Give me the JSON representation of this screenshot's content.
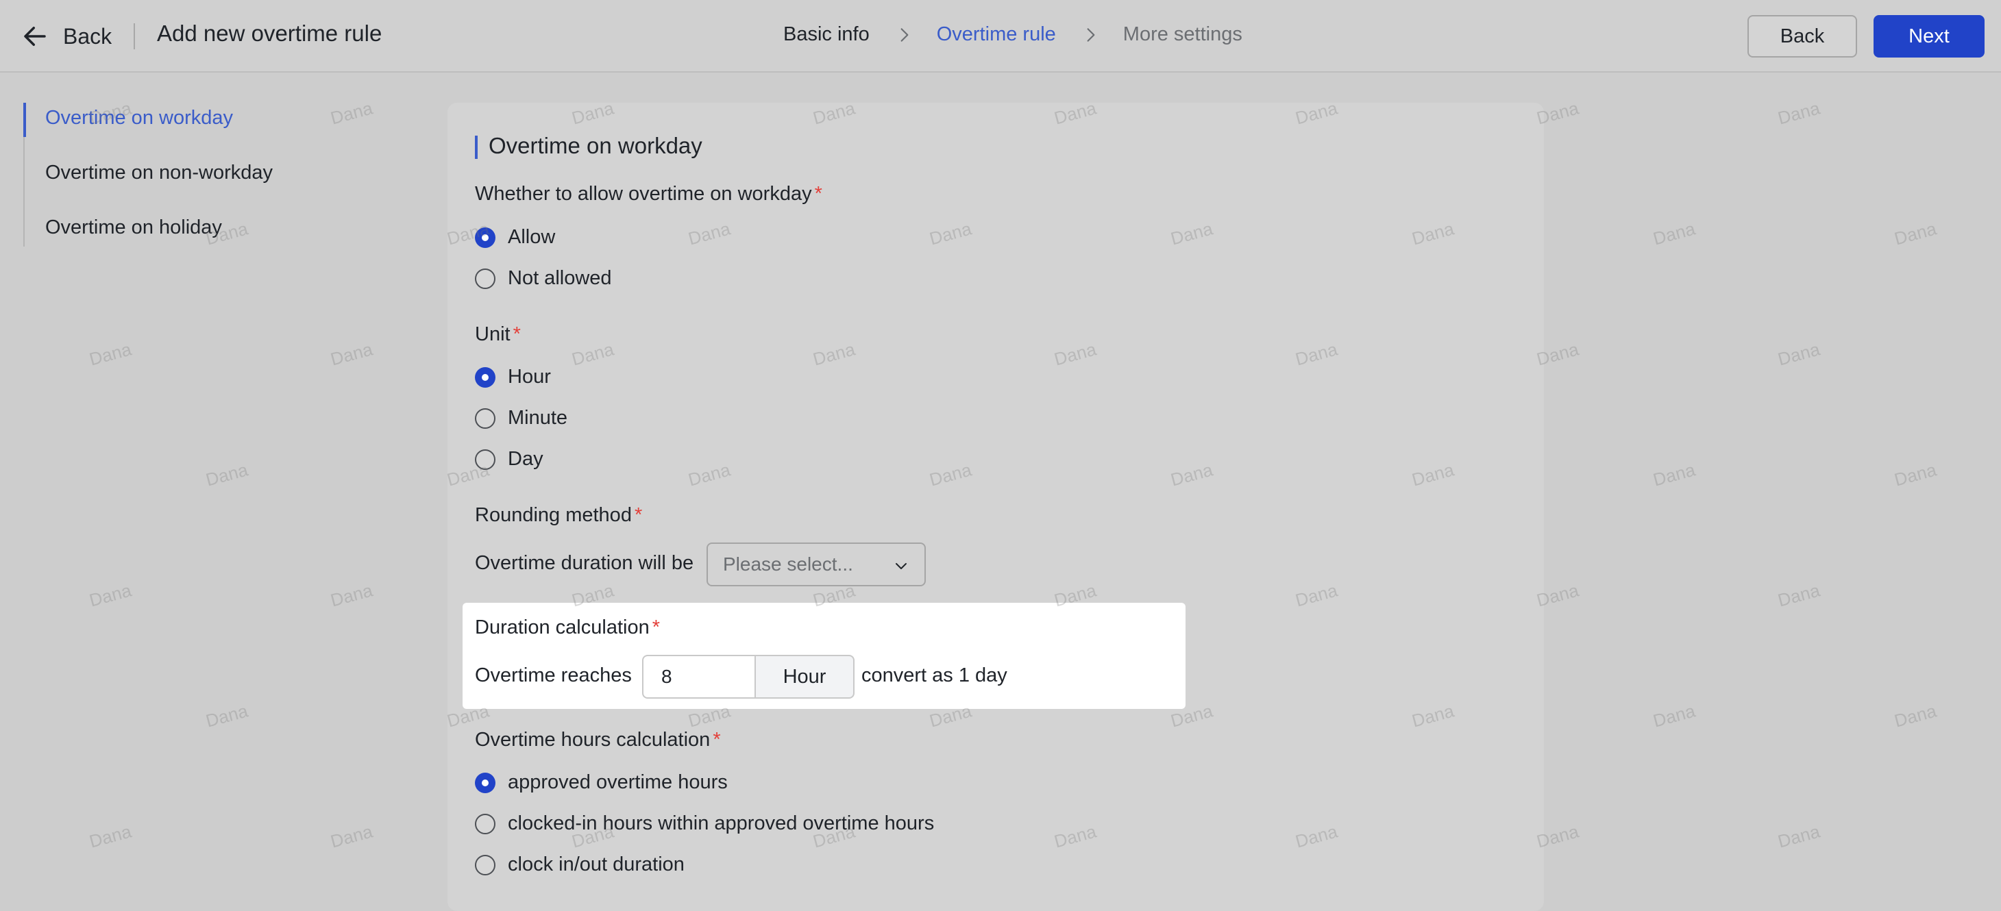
{
  "header": {
    "back_label": "Back",
    "title": "Add new overtime rule",
    "steps": [
      {
        "label": "Basic info",
        "state": "done"
      },
      {
        "label": "Overtime rule",
        "state": "active"
      },
      {
        "label": "More settings",
        "state": "pending"
      }
    ],
    "back_button": "Back",
    "next_button": "Next"
  },
  "sidebar": {
    "items": [
      {
        "label": "Overtime on workday",
        "active": true
      },
      {
        "label": "Overtime on non-workday",
        "active": false
      },
      {
        "label": "Overtime on holiday",
        "active": false
      }
    ]
  },
  "section": {
    "title": "Overtime on workday",
    "allow": {
      "label": "Whether to allow overtime on workday",
      "required_mark": "*",
      "options": [
        {
          "label": "Allow",
          "checked": true
        },
        {
          "label": "Not allowed",
          "checked": false
        }
      ]
    },
    "unit": {
      "label": "Unit",
      "required_mark": "*",
      "options": [
        {
          "label": "Hour",
          "checked": true
        },
        {
          "label": "Minute",
          "checked": false
        },
        {
          "label": "Day",
          "checked": false
        }
      ]
    },
    "rounding": {
      "label": "Rounding method",
      "required_mark": "*",
      "prefix": "Overtime duration will be",
      "select_placeholder": "Please select..."
    },
    "duration": {
      "label": "Duration calculation",
      "required_mark": "*",
      "prefix": "Overtime reaches",
      "value": "8",
      "addon": "Hour",
      "suffix": "convert as 1 day"
    },
    "hours_calc": {
      "label": "Overtime hours calculation",
      "required_mark": "*",
      "options": [
        {
          "label": "approved overtime hours",
          "checked": true
        },
        {
          "label": "clocked-in hours within approved overtime hours",
          "checked": false
        },
        {
          "label": "clock in/out duration",
          "checked": false
        }
      ]
    }
  },
  "watermark_text": "Dana",
  "colors": {
    "accent": "#2143c8",
    "active_text": "#3a5cc9",
    "required": "#e3403a"
  }
}
